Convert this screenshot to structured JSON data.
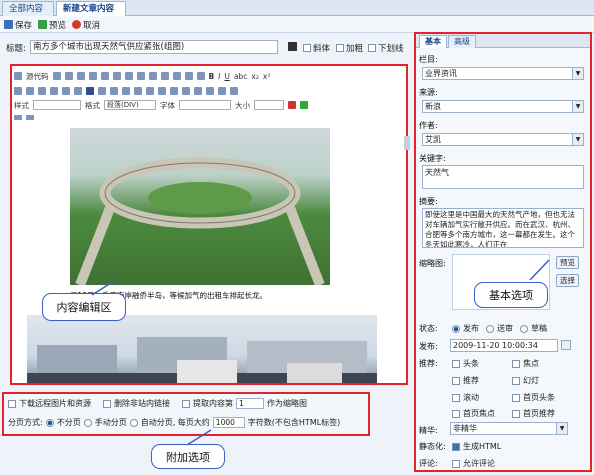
{
  "tabs": [
    {
      "label": "全部内容",
      "active": false
    },
    {
      "label": "新建文章内容",
      "active": true
    }
  ],
  "toolbar": {
    "save": "保存",
    "preview": "预览",
    "cancel": "取消"
  },
  "title_field": {
    "label": "标题:",
    "value": "南方多个城市出现天然气供应紧张(组图)",
    "italic": "斜体",
    "bold": "加粗",
    "underline": "下划线"
  },
  "editor": {
    "row1": [
      "源代码"
    ],
    "style_label": "样式",
    "format_label": "格式",
    "format_value": "段落(DIV)",
    "font_label": "字体",
    "size_label": "大小",
    "caption": "月13日，重庆南岸融侨半岛，等候加气的出租车排起长龙。",
    "callout": "内容编辑区"
  },
  "extra": {
    "download_remote": "下载远程图片和资源",
    "remove_links": "删除非站内链接",
    "extract_content": "提取内容第",
    "extract_value": "1",
    "as_thumb": "作为缩略图",
    "paging_label": "分页方式:",
    "no_paging": "不分页",
    "manual_paging": "手动分页",
    "auto_paging": "自动分页, 每页大约",
    "chars_value": "1000",
    "chars_note": "字符数(不包含HTML标签)",
    "callout": "附加选项"
  },
  "right": {
    "tabs": [
      {
        "label": "基本",
        "active": true
      },
      {
        "label": "高级",
        "active": false
      }
    ],
    "column_label": "栏目:",
    "column_value": "业界资讯",
    "source_label": "来源:",
    "source_value": "新浪",
    "author_label": "作者:",
    "author_value": "艾凯",
    "keywords_label": "关键字:",
    "keywords_value": "天然气",
    "summary_label": "摘要:",
    "summary_value": "即使这里是中国最大的天然气产地，但也无法对车辆加气实行敞开供应。而在武汉、杭州、合肥等多个南方城市，这一幕都在发生。这个冬天如此寒冷，人们正在",
    "thumb_label": "缩略图:",
    "preview_btn": "预览",
    "select_btn": "选择",
    "callout": "基本选项",
    "status_label": "状态:",
    "status_options": [
      "发布",
      "送审",
      "草稿"
    ],
    "publish_label": "发布:",
    "publish_value": "2009-11-20 10:00:34",
    "recommend_label": "推荐:",
    "recommend_options": [
      [
        "头条",
        "焦点"
      ],
      [
        "推荐",
        "幻灯"
      ],
      [
        "滚动",
        "首页头条"
      ],
      [
        "首页焦点",
        "首页推荐"
      ]
    ],
    "quality_label": "精华:",
    "quality_value": "非精华",
    "static_label": "静态化:",
    "static_option": "生成HTML",
    "comment_label": "评论:",
    "comment_option": "允许评论"
  },
  "colors": {
    "accent": "#15428b",
    "highlight": "#e3232b",
    "callout_border": "#3a60c4"
  }
}
